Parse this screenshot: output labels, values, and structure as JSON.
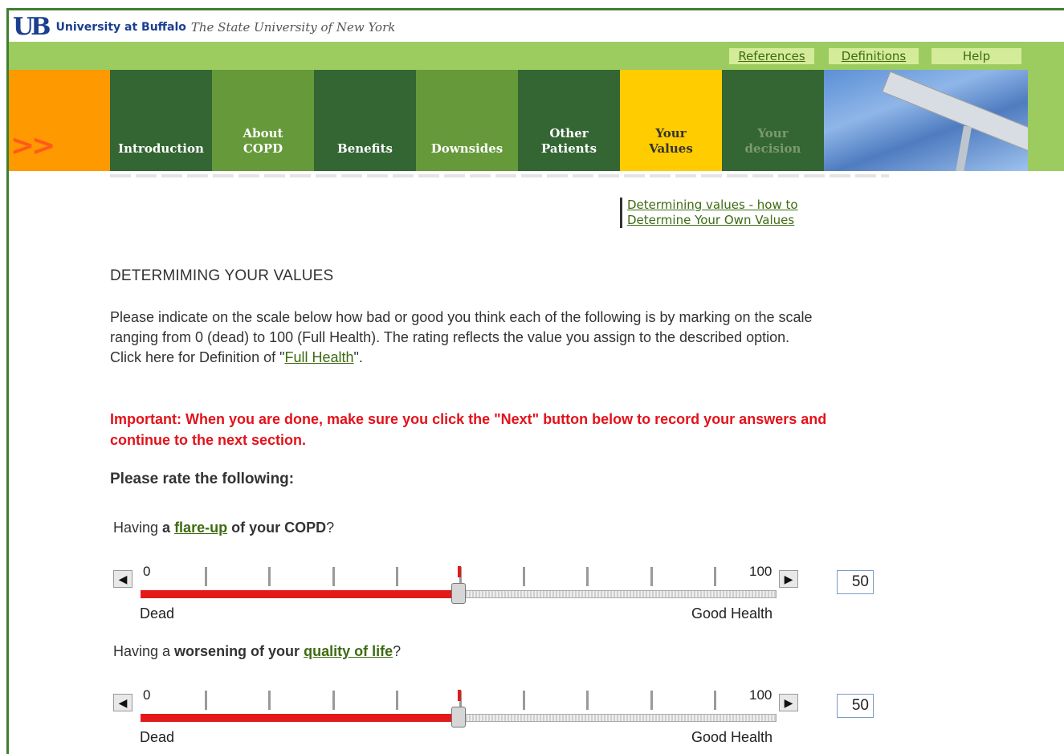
{
  "header": {
    "logo_mark": "UB",
    "university_name": "University at Buffalo",
    "university_subtitle": "The State University of New York"
  },
  "utility_links": [
    {
      "label": "References"
    },
    {
      "label": "Definitions"
    },
    {
      "label": "Help"
    }
  ],
  "nav": {
    "arrow_glyph": ">>",
    "tabs": [
      {
        "label": "Introduction",
        "state": "normal"
      },
      {
        "label": "About COPD",
        "state": "normal"
      },
      {
        "label": "Benefits",
        "state": "normal"
      },
      {
        "label": "Downsides",
        "state": "normal"
      },
      {
        "label": "Other Patients",
        "state": "normal"
      },
      {
        "label": "Your Values",
        "state": "active"
      },
      {
        "label": "Your decision",
        "state": "disabled"
      }
    ]
  },
  "side_links": [
    {
      "label": "Determining values - how to"
    },
    {
      "label": "Determine Your Own Values"
    }
  ],
  "main": {
    "title": "DETERMIMING YOUR VALUES",
    "instructions_line1": "Please indicate on the scale below how bad or good you think each of the following is by marking on the scale ranging from 0 (dead) to 100 (Full Health). The rating reflects the value you assign to the described option.",
    "definition_prefix": "Click here for Definition of \"",
    "definition_link": "Full Health",
    "definition_suffix": "\".",
    "important": "Important: When you are done, make sure you click the \"Next\" button below to record your answers and continue to the next section.",
    "rate_heading": "Please rate the following:"
  },
  "questions": [
    {
      "prefix": "Having ",
      "bold1": "a",
      "link": "flare-up",
      "bold2": "of your COPD",
      "suffix": "?",
      "min_label": "0",
      "max_label": "100",
      "left_label": "Dead",
      "right_label": "Good Health",
      "value": "50",
      "fraction": 0.5
    },
    {
      "prefix": "Having a ",
      "bold1": "worsening of your",
      "link": "quality of life",
      "bold2": "",
      "suffix": "?",
      "min_label": "0",
      "max_label": "100",
      "left_label": "Dead",
      "right_label": "Good Health",
      "value": "50",
      "fraction": 0.5
    }
  ],
  "colors": {
    "dark_green": "#336633",
    "mid_green": "#66993a",
    "light_green": "#9ccc5f",
    "active_tab": "#ffcc00",
    "orange": "#ff9900",
    "important_red": "#e3121b",
    "link_green": "#3d6b12"
  }
}
